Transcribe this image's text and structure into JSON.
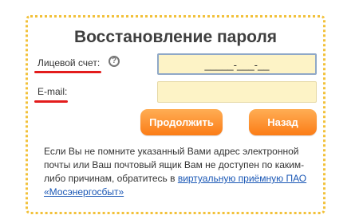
{
  "form": {
    "title": "Восстановление пароля",
    "account_label": "Лицевой счет:",
    "account_help_icon": "question-circle-icon",
    "account_value": "_____-___-__",
    "email_label": "E-mail:",
    "email_value": "",
    "continue_label": "Продолжить",
    "back_label": "Назад",
    "note_text": "Если Вы не помните указанный Вами адрес электронной почты или Ваш почтовый ящик Вам не доступен по каким-либо причинам, обратитесь в",
    "note_link": "виртуальную приёмную ПАО «Мосэнергосбыт»"
  },
  "colors": {
    "accent": "#fb7c16",
    "field": "#fdf3c6",
    "panel_border": "#f2c13a",
    "annotation": "#e31c1c",
    "link": "#1a57b5"
  }
}
